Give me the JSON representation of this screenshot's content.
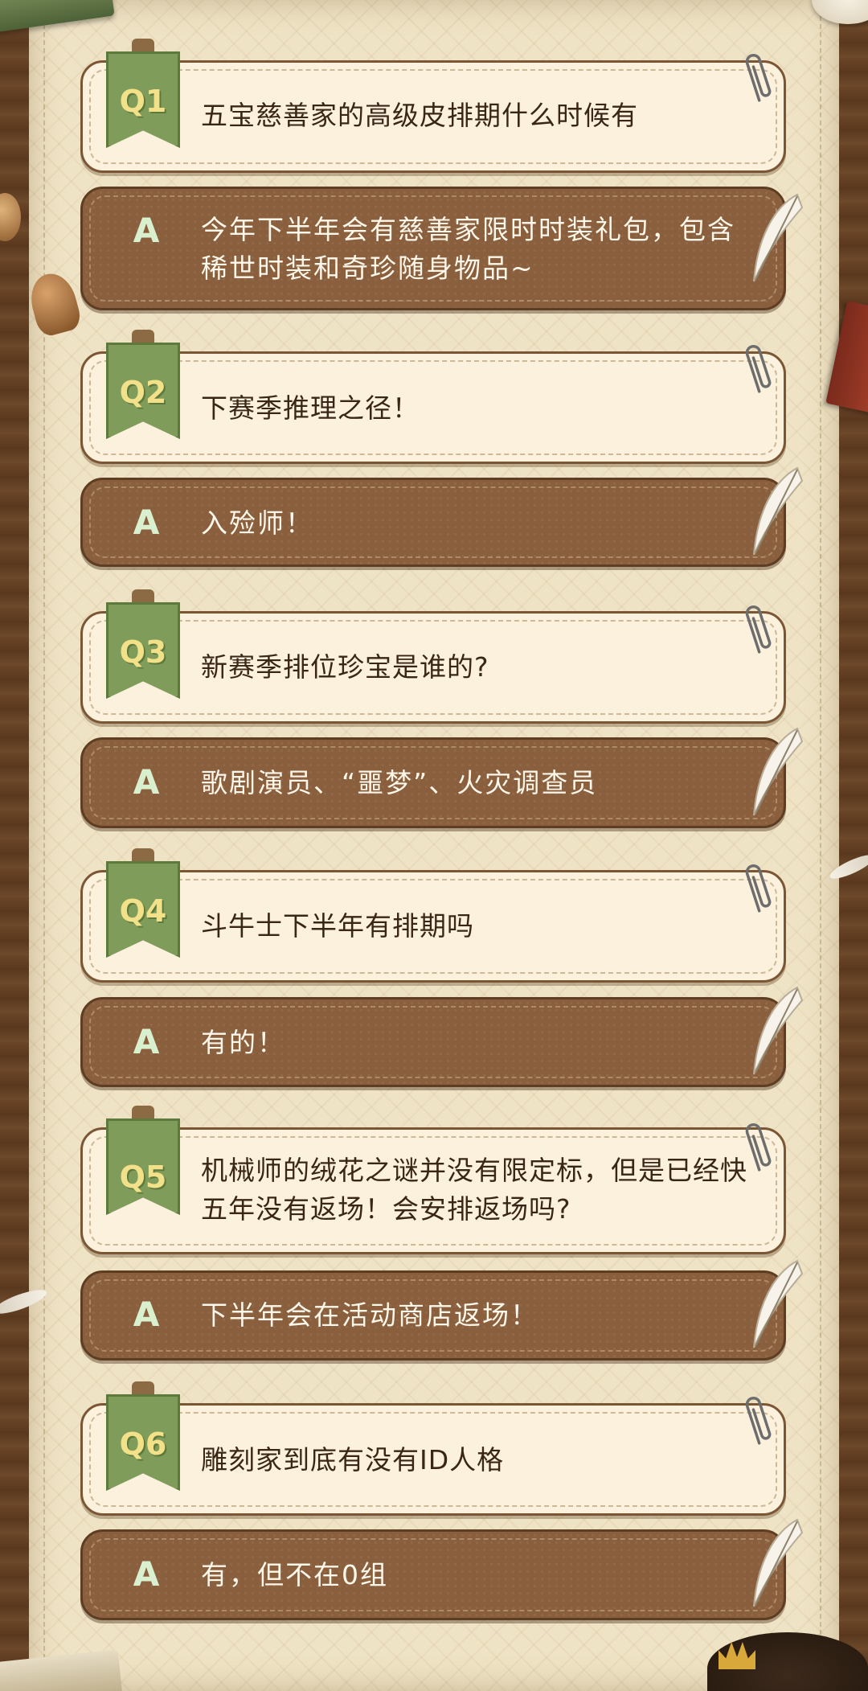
{
  "faq": {
    "items": [
      {
        "q_label": "Q1",
        "question": "五宝慈善家的高级皮排期什么时候有",
        "a_label": "A",
        "answer": "今年下半年会有慈善家限时时装礼包，包含稀世时装和奇珍随身物品~"
      },
      {
        "q_label": "Q2",
        "question": "下赛季推理之径！",
        "a_label": "A",
        "answer": "入殓师！"
      },
      {
        "q_label": "Q3",
        "question": "新赛季排位珍宝是谁的?",
        "a_label": "A",
        "answer": "歌剧演员、“噩梦”、火灾调查员"
      },
      {
        "q_label": "Q4",
        "question": "斗牛士下半年有排期吗",
        "a_label": "A",
        "answer": "有的！"
      },
      {
        "q_label": "Q5",
        "question": "机械师的绒花之谜并没有限定标，但是已经快五年没有返场！会安排返场吗?",
        "a_label": "A",
        "answer": "下半年会在活动商店返场！"
      },
      {
        "q_label": "Q6",
        "question": "雕刻家到底有没有ID人格",
        "a_label": "A",
        "answer": "有，但不在0组"
      }
    ]
  },
  "colors": {
    "paper": "#efe3c5",
    "question_card": "#fbf1dd",
    "answer_card": "#8a5f3d",
    "badge_green": "#7f9c5a",
    "badge_text": "#f3e18a",
    "answer_letter": "#d9f0cf"
  }
}
